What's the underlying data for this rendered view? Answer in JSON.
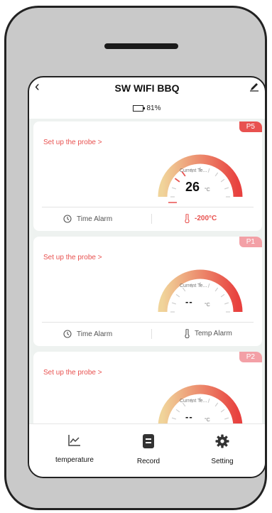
{
  "app": {
    "title": "SW WIFI BBQ",
    "battery": {
      "percent_label": "81%",
      "level": 0.81
    }
  },
  "probes": [
    {
      "tag": "P5",
      "tag_color": "#e8514f",
      "setup_label": "Set up the probe >",
      "current_label": "Current Te...",
      "current_value": "26",
      "unit": "°C",
      "time_alarm_label": "Time Alarm",
      "temp_alarm_label": "-200°C",
      "temp_alarm_set": true
    },
    {
      "tag": "P1",
      "tag_color": "#f3a0a6",
      "setup_label": "Set up the probe >",
      "current_label": "Current Te...",
      "current_value": "--",
      "unit": "°C",
      "time_alarm_label": "Time Alarm",
      "temp_alarm_label": "Temp Alarm",
      "temp_alarm_set": false
    },
    {
      "tag": "P2",
      "tag_color": "#f3a0a6",
      "setup_label": "Set up the probe >",
      "current_label": "Current Te...",
      "current_value": "--",
      "unit": "°C"
    }
  ],
  "nav": {
    "temperature_label": "temperature",
    "record_label": "Record",
    "setting_label": "Setting"
  },
  "colors": {
    "accent": "#e8514f",
    "gauge_start": "#f0d49a",
    "gauge_end": "#e8413f",
    "list_bg": "#eef2f0"
  }
}
